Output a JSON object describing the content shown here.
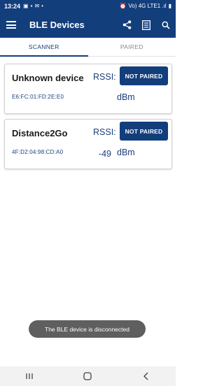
{
  "status_bar": {
    "time": "13:24",
    "right_text": "Vo) 4G LTE1 .ıl"
  },
  "app_bar": {
    "title": "BLE Devices",
    "background_color": "#133e7c",
    "icons": [
      "menu-icon",
      "share-icon",
      "list-icon",
      "search-icon"
    ]
  },
  "tabs": [
    {
      "label": "SCANNER",
      "active": true
    },
    {
      "label": "PAIRED",
      "active": false
    }
  ],
  "devices": [
    {
      "name": "Unknown device",
      "mac": "E6:FC:01:FD:2E:E0",
      "rssi_label": "RSSI:",
      "rssi_value": "",
      "rssi_unit": "dBm",
      "button_label": "NOT PAIRED"
    },
    {
      "name": "Distance2Go",
      "mac": "4F:D2:04:98:CD:A0",
      "rssi_label": "RSSI:",
      "rssi_value": "-49",
      "rssi_unit": "dBm",
      "button_label": "NOT PAIRED"
    }
  ],
  "toast": {
    "message": "The BLE device is disconnected"
  },
  "nav_bar": {
    "icons": [
      "recent-apps-icon",
      "home-icon",
      "back-icon"
    ]
  }
}
